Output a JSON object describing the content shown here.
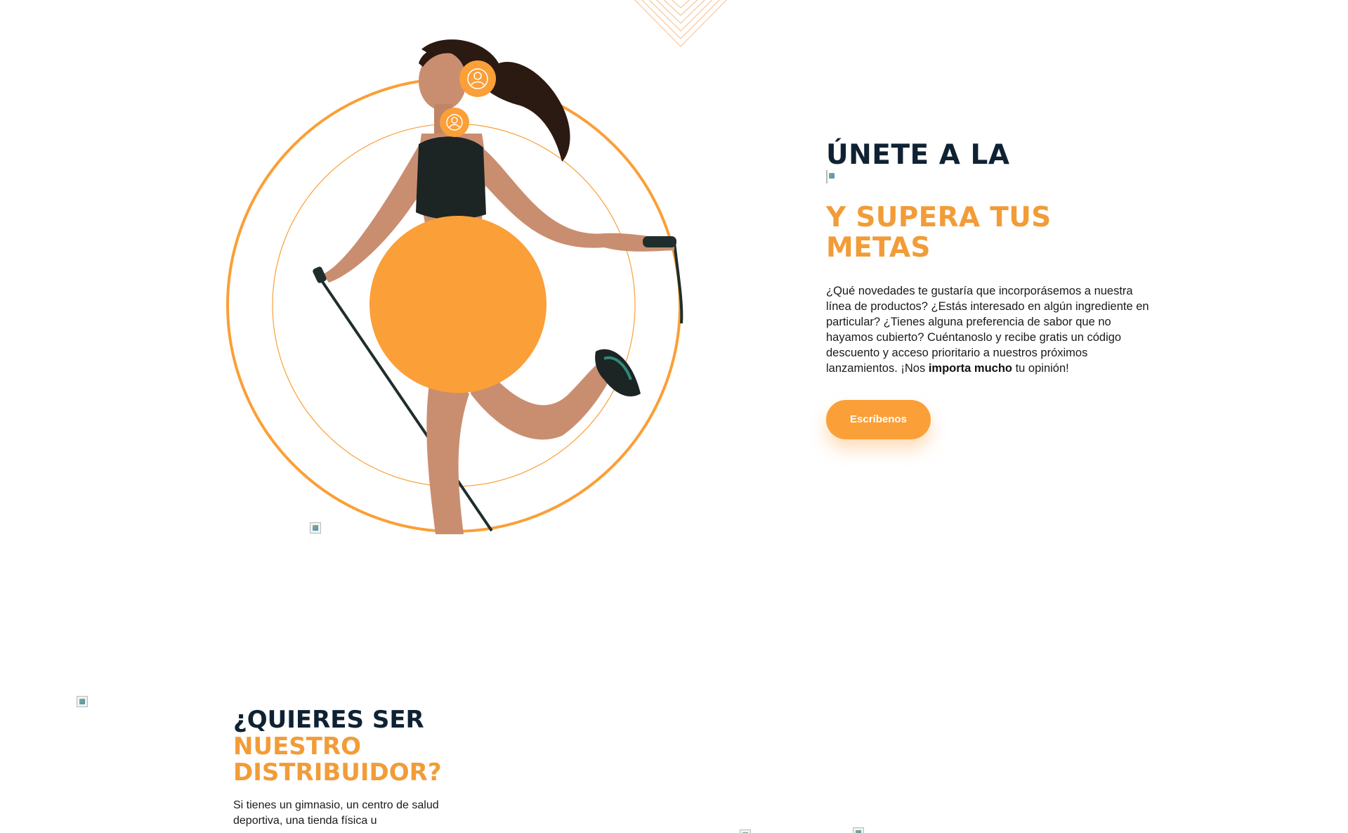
{
  "join_section": {
    "title": "ÚNETE A LA",
    "subtitle": "Y SUPERA TUS METAS",
    "body_before_bold": "¿Qué novedades te gustaría que incorporásemos a nuestra línea de productos? ¿Estás interesado en algún ingrediente en particular? ¿Tienes alguna preferencia de sabor que no hayamos cubierto? Cuéntanoslo y recibe gratis un código descuento y acceso prioritario a nuestros próximos lanzamientos. ¡Nos ",
    "body_bold": "importa mucho",
    "body_after_bold": " tu opinión!",
    "cta_label": "Escríbenos"
  },
  "distributor_section": {
    "line1": "¿QUIERES SER",
    "line2": "NUESTRO",
    "line3": "DISTRIBUIDOR?",
    "body": "Si tienes un gimnasio, un centro de salud deportiva, una tienda física u"
  },
  "colors": {
    "accent": "#fb9f38",
    "accent_text": "#f29c38",
    "heading_dark": "#0f2233",
    "body_text": "#1a1a1a"
  },
  "icons": {
    "hero_badges": [
      "user-icon",
      "user-icon"
    ],
    "decor": "chevron-pattern-icon"
  }
}
